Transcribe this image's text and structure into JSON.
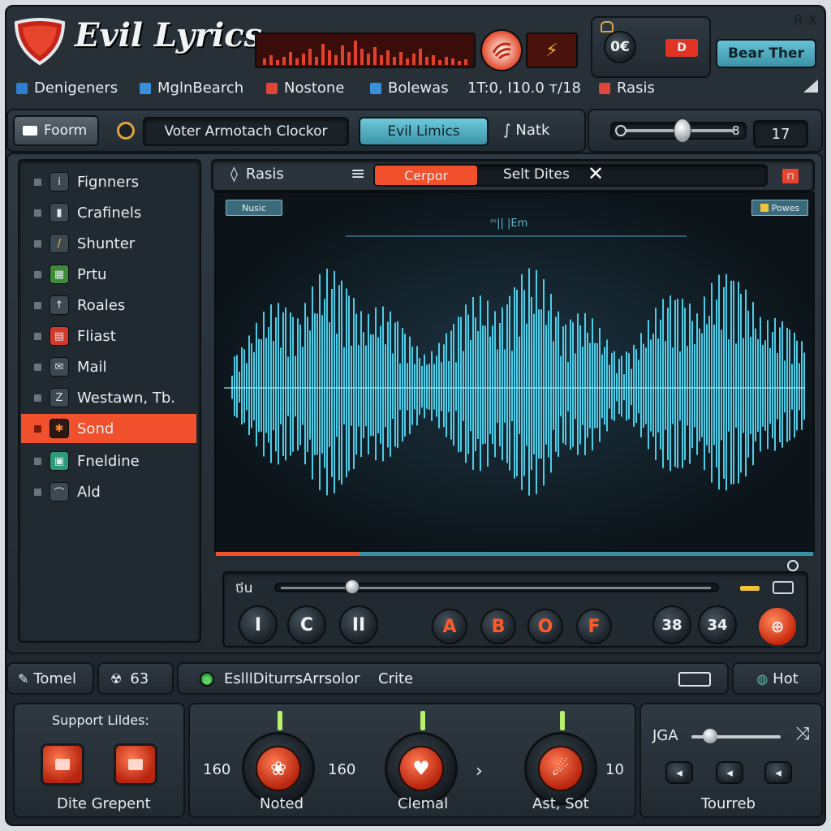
{
  "app": {
    "title": "Evil Lyrics",
    "close_label": "R X",
    "header_button": "Bear Ther",
    "counter": "0€",
    "record_badge": "D"
  },
  "menu": [
    {
      "label": "Denigeners",
      "color": "#2f7fd0"
    },
    {
      "label": "MglnBearch",
      "color": "#3a8fd8"
    },
    {
      "label": "Nostone",
      "color": "#e0453a"
    },
    {
      "label": "Bolewas",
      "color": "#3a8fd8"
    },
    {
      "label": "1T:0, I10.0 т/18",
      "color": ""
    },
    {
      "label": "Rasis",
      "color": "#e0453a"
    }
  ],
  "toolbar": {
    "form_tab": "Foorm",
    "source_field": "Voter Armotach Clockor",
    "active_tab": "Evil Limics",
    "net_tab": "Natk",
    "volume_value": "17",
    "slider_end_label": "8"
  },
  "sidebar": {
    "items": [
      {
        "label": "Fignners",
        "icon": "info-icon",
        "glyph": "i"
      },
      {
        "label": "Crafinels",
        "icon": "jar-icon",
        "glyph": "▮"
      },
      {
        "label": "Shunter",
        "icon": "pen-icon",
        "glyph": "/"
      },
      {
        "label": "Prtu",
        "icon": "grid-icon",
        "glyph": "▦"
      },
      {
        "label": "Roales",
        "icon": "arrow-up-icon",
        "glyph": "↑"
      },
      {
        "label": "Fliast",
        "icon": "document-icon",
        "glyph": "▤"
      },
      {
        "label": "Mail",
        "icon": "mail-icon",
        "glyph": "✉"
      },
      {
        "label": "Westawn, Tb.",
        "icon": "z-icon",
        "glyph": "Z"
      },
      {
        "label": "Sond",
        "icon": "star-icon",
        "glyph": "✱",
        "active": true
      },
      {
        "label": "Fneldine",
        "icon": "image-icon",
        "glyph": "▣"
      },
      {
        "label": "Ald",
        "icon": "mic-icon",
        "glyph": "⌒"
      }
    ]
  },
  "editor": {
    "tab_label": "Rasis",
    "mode_active": "Cerpor",
    "mode_other": "Selt Dites",
    "badge_left": "Nusic",
    "badge_right": "Powes",
    "waveform_caption": "ᵐ|| |Em",
    "progress": 0.24
  },
  "transport": {
    "time_label": "ថu",
    "position": 0.16,
    "buttons_left": [
      "I",
      "C",
      "II"
    ],
    "buttons_mid": [
      "A",
      "B",
      "O",
      "F"
    ],
    "buttons_right": [
      "38",
      "34"
    ]
  },
  "statusbar": {
    "tomel": "Tomel",
    "count": "63",
    "path": "EslllDiturrsArrsolor",
    "crite": "Crite",
    "hot": "Hot"
  },
  "bottom": {
    "support_title": "Support Lildes:",
    "support_caption": "Dite Grepent",
    "knobs": [
      {
        "caption": "Noted",
        "left": "160",
        "right": "160"
      },
      {
        "caption": "Clemal",
        "left": "",
        "right": "›"
      },
      {
        "caption": "Ast, Sot",
        "left": "",
        "right": "10"
      }
    ],
    "right_label": "JGA",
    "right_caption": "Tourreb"
  },
  "colors": {
    "accent": "#f0502b",
    "wave": "#4fd6f2",
    "teal_button": "#4aa9bd"
  }
}
